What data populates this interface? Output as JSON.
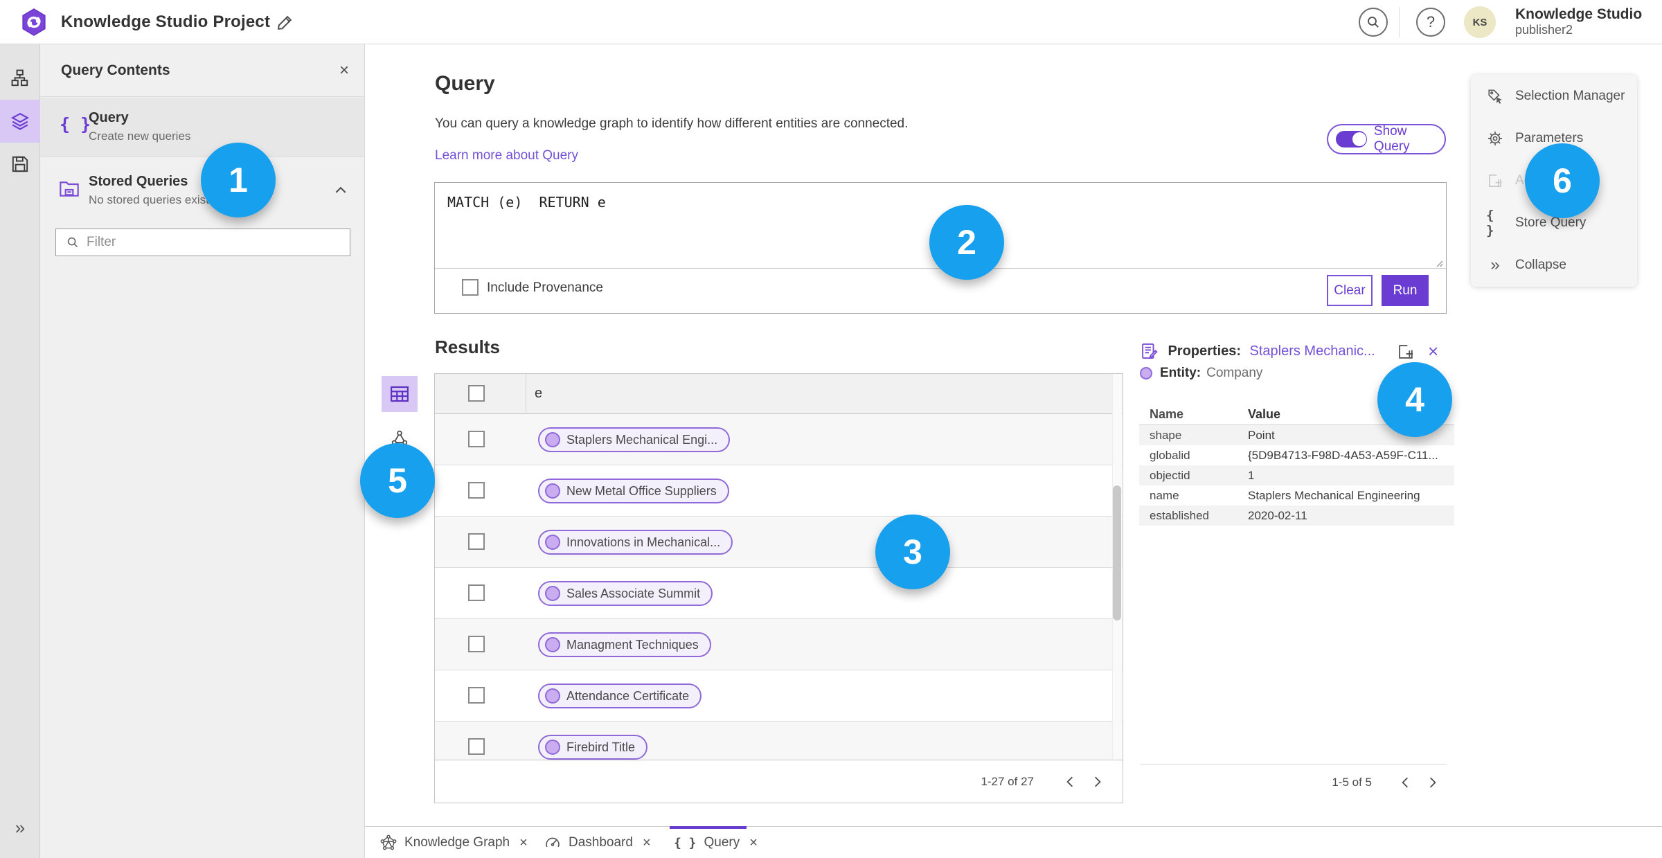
{
  "glyphs": {
    "close": "×",
    "braces": "{ }",
    "help": "?",
    "double_chevron": "»"
  },
  "colors": {
    "accent_purple": "#6a3cd2",
    "link_purple": "#7450d9",
    "selected_lavender": "#d9c7f6",
    "chip_fill": "#f4f0fb",
    "chip_border": "#8f6ad8",
    "callout_blue": "#17a0ee",
    "avatar_yellow": "#ece8c6"
  },
  "topbar": {
    "title": "Knowledge Studio Project",
    "avatar_initials": "KS",
    "user_name": "Knowledge Studio",
    "user_role": "publisher2"
  },
  "left_panel": {
    "title": "Query Contents",
    "query_item": {
      "label": "Query",
      "description": "Create new queries"
    },
    "stored_item": {
      "label": "Stored Queries",
      "description": "No stored queries exist"
    },
    "filter_placeholder": "Filter"
  },
  "query_section": {
    "title": "Query",
    "description": "You can query a knowledge graph to identify how different entities are connected.",
    "learn_more": "Learn more about Query",
    "show_query_label": "Show Query",
    "query_text": "MATCH (e)  RETURN e",
    "include_provenance_label": "Include Provenance",
    "clear_label": "Clear",
    "run_label": "Run"
  },
  "results": {
    "title": "Results",
    "column_header": "e",
    "rows": [
      "Staplers Mechanical Engi...",
      "New Metal Office Suppliers",
      "Innovations in Mechanical...",
      "Sales Associate Summit",
      "Managment Techniques",
      "Attendance Certificate",
      "Firebird Title"
    ],
    "pagination": "1-27 of 27"
  },
  "properties_panel": {
    "title": "Properties:",
    "entity_link": "Staplers Mechanic...",
    "entity_label": "Entity:",
    "entity_type": "Company",
    "columns": [
      "Name",
      "Value"
    ],
    "rows": [
      {
        "name": "shape",
        "value": "Point"
      },
      {
        "name": "globalid",
        "value": "{5D9B4713-F98D-4A53-A59F-C11..."
      },
      {
        "name": "objectid",
        "value": "1"
      },
      {
        "name": "name",
        "value": "Staplers Mechanical Engineering"
      },
      {
        "name": "established",
        "value": "2020-02-11"
      }
    ],
    "pagination": "1-5 of 5"
  },
  "tools_menu": {
    "items": [
      {
        "label": "Selection Manager",
        "disabled": false
      },
      {
        "label": "Parameters",
        "disabled": false
      },
      {
        "label": "Add To Map",
        "disabled": true
      },
      {
        "label": "Store Query",
        "disabled": false
      },
      {
        "label": "Collapse",
        "disabled": false
      }
    ]
  },
  "bottom_tabs": [
    {
      "label": "Knowledge Graph",
      "active": false
    },
    {
      "label": "Dashboard",
      "active": false
    },
    {
      "label": "Query",
      "active": true
    }
  ],
  "callouts": [
    "1",
    "2",
    "3",
    "4",
    "5",
    "6"
  ]
}
